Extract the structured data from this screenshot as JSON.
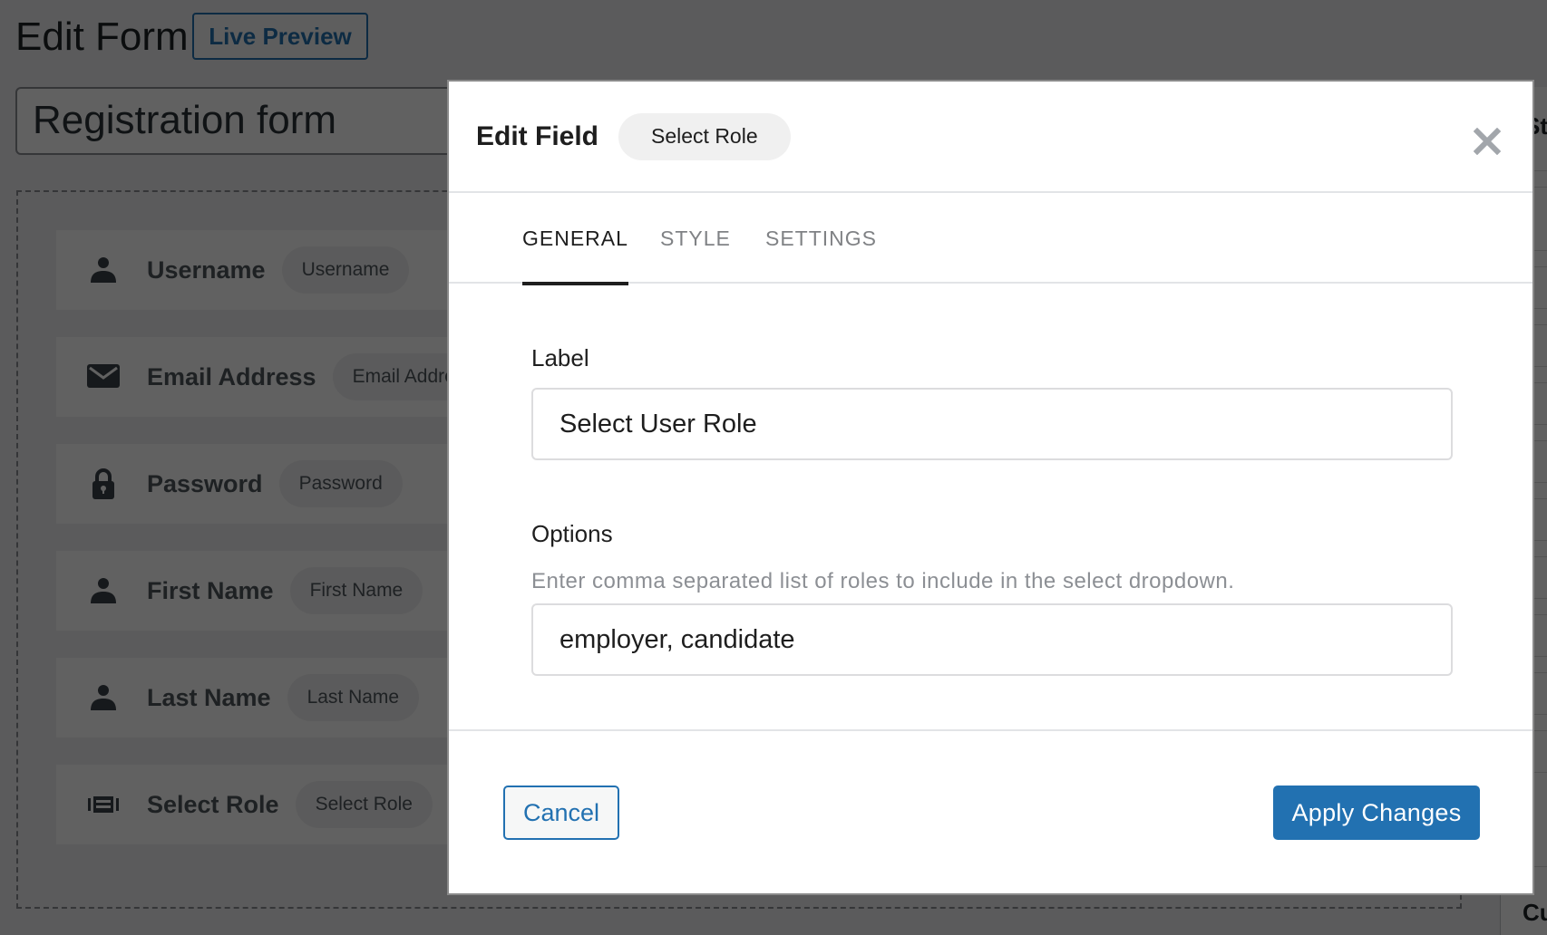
{
  "background": {
    "page_title": "Edit Form",
    "live_preview_label": "Live Preview",
    "form_name": "Registration form",
    "fields": [
      {
        "icon": "user-icon",
        "label": "Username",
        "tag": "Username"
      },
      {
        "icon": "envelope-icon",
        "label": "Email Address",
        "tag": "Email Address"
      },
      {
        "icon": "lock-icon",
        "label": "Password",
        "tag": "Password"
      },
      {
        "icon": "user-icon",
        "label": "First Name",
        "tag": "First Name"
      },
      {
        "icon": "user-icon",
        "label": "Last Name",
        "tag": "Last Name"
      },
      {
        "icon": "select-list-icon",
        "label": "Select Role",
        "tag": "Select Role"
      }
    ],
    "right_panel_title_partial": "St",
    "right_panel_bottom_partial": "Cu"
  },
  "modal": {
    "title": "Edit Field",
    "field_tag": "Select Role",
    "close_icon": "close-icon",
    "tabs": [
      {
        "label": "GENERAL",
        "active": true
      },
      {
        "label": "STYLE",
        "active": false
      },
      {
        "label": "SETTINGS",
        "active": false
      }
    ],
    "label_field": {
      "label": "Label",
      "value": "Select User Role"
    },
    "options_field": {
      "label": "Options",
      "help": "Enter comma separated list of roles to include in the select dropdown.",
      "value": "employer, candidate"
    },
    "cancel_label": "Cancel",
    "apply_label": "Apply Changes"
  },
  "colors": {
    "accent": "#2271b1",
    "overlay": "rgba(0,0,0,0.62)",
    "tab_active": "#1e1e1e",
    "tab_inactive": "#808285"
  }
}
